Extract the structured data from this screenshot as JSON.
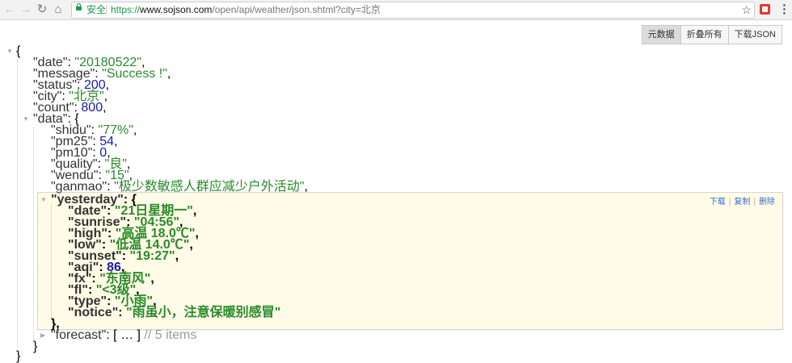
{
  "browser": {
    "secure_label": "安全",
    "url_scheme": "https://",
    "url_host": "www.sojson.com",
    "url_path": "/open/api/weather/json.shtml?city=北京"
  },
  "actions": {
    "raw": "元数据",
    "collapse_all": "折叠所有",
    "download_json": "下载JSON"
  },
  "node_actions": {
    "download": "下载",
    "copy": "复制",
    "delete": "删除"
  },
  "json": {
    "date": "20180522",
    "message": "Success !",
    "status": "200",
    "city": "北京",
    "count": "800",
    "data": {
      "shidu": "77%",
      "pm25": "54",
      "pm10": "0",
      "quality": "良",
      "wendu": "15",
      "ganmao": "极少数敏感人群应减少户外活动",
      "yesterday": {
        "date": "21日星期一",
        "sunrise": "04:56",
        "high": "高温 18.0℃",
        "low": "低温 14.0℃",
        "sunset": "19:27",
        "aqi": "86",
        "fx": "东南风",
        "fl": "<3级",
        "type": "小雨",
        "notice": "雨虽小，注意保暖别感冒"
      },
      "forecast_summary": "[ … ]",
      "forecast_comment": "// 5 items"
    }
  }
}
